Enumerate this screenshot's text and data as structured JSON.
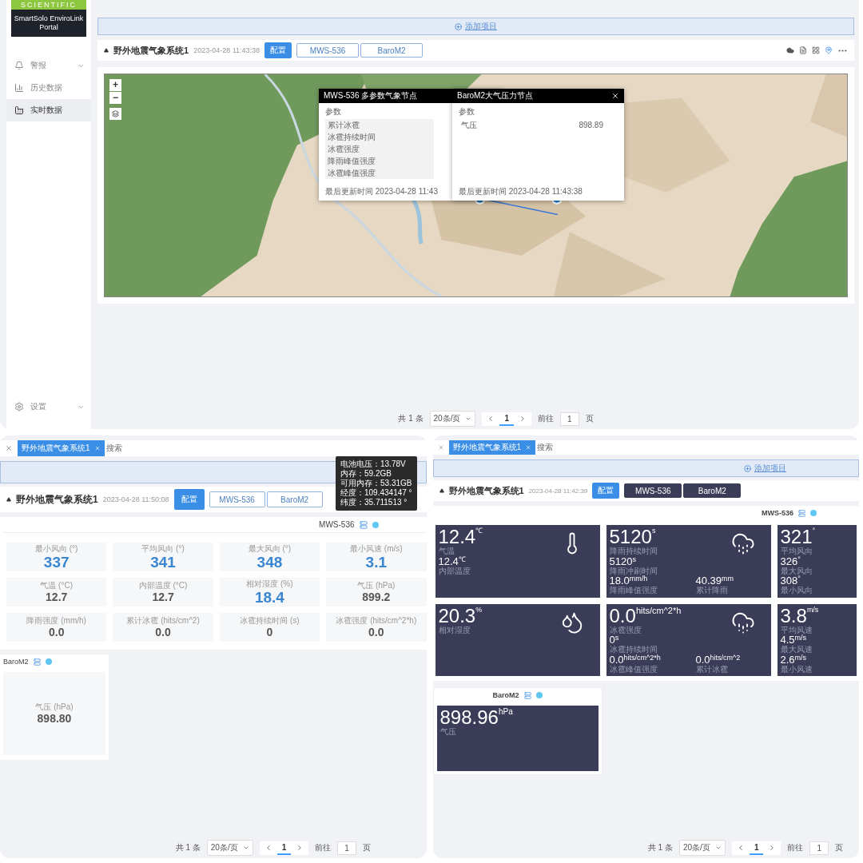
{
  "top": {
    "sidebar": {
      "logo_tagline": "SCIENTIFIC",
      "logo_title": "SmartSolo EnviroLink Portal",
      "items": [
        {
          "label": "警报",
          "kind": "bell",
          "expandable": true,
          "selected": false
        },
        {
          "label": "历史数据",
          "kind": "chart",
          "expandable": false,
          "selected": false
        },
        {
          "label": "实时数据",
          "kind": "factory",
          "expandable": false,
          "selected": true
        }
      ],
      "footer_item": {
        "label": "设置",
        "kind": "gear",
        "expandable": true
      }
    },
    "add_bar": "添加项目",
    "header": {
      "title": "野外地震气象系统1",
      "time": "2023-04-28 11:43:38",
      "config_button": "配置",
      "node_tabs": [
        "MWS-536",
        "BaroM2"
      ]
    },
    "map": {
      "zoom_in": "+",
      "zoom_out": "−",
      "popups": [
        {
          "title": "MWS-536 多参数气象节点",
          "param_header": "参数",
          "rows": [
            {
              "name": "累计冰雹"
            },
            {
              "name": "冰雹持续时间"
            },
            {
              "name": "冰雹强度"
            },
            {
              "name": "降雨峰值强度"
            },
            {
              "name": "冰雹峰值强度"
            }
          ],
          "updated": "最后更新时间  2023-04-28 11:43"
        },
        {
          "title": "BaroM2大气压力节点",
          "param_header": "参数",
          "rows": [
            {
              "name": "气压",
              "value": "898.89"
            }
          ],
          "updated": "最后更新时间  2023-04-28 11:43:38"
        }
      ]
    },
    "pagination": {
      "total": "共 1 条",
      "page_size": "20条/页",
      "pages": [
        {
          "label": "1",
          "selected": true
        }
      ],
      "goto_label": "前往",
      "goto_value": "1",
      "goto_suffix": "页"
    }
  },
  "left": {
    "tabs": [
      {
        "label": "野外地震气象系统1",
        "selected": true
      }
    ],
    "search": "搜索",
    "header": {
      "title": "野外地震气象系统1",
      "time": "2023-04-28 11:50:08",
      "config_button": "配置",
      "node_tabs": [
        "MWS-536",
        "BaroM2"
      ]
    },
    "tooltip": [
      "电池电压：13.78V",
      "内存：59.2GB",
      "可用内存：53.31GB",
      "经度：109.434147 °",
      "纬度：35.711513 °"
    ],
    "node": "MWS-536",
    "stats": [
      {
        "label": "最小风向 (°)",
        "value": "337",
        "highlight": true
      },
      {
        "label": "平均风向 (°)",
        "value": "341",
        "highlight": true
      },
      {
        "label": "最大风向 (°)",
        "value": "348",
        "highlight": true
      },
      {
        "label": "最小风速 (m/s)",
        "value": "3.1",
        "highlight": true
      },
      {
        "label": "气温 (°C)",
        "value": "12.7",
        "highlight": false
      },
      {
        "label": "内部温度 (°C)",
        "value": "12.7",
        "highlight": false
      },
      {
        "label": "相对湿度 (%)",
        "value": "18.4",
        "highlight": true
      },
      {
        "label": "气压 (hPa)",
        "value": "899.2",
        "highlight": false
      },
      {
        "label": "降雨强度 (mm/h)",
        "value": "0.0",
        "highlight": false
      },
      {
        "label": "累计冰雹 (hits/cm^2)",
        "value": "0.0",
        "highlight": false
      },
      {
        "label": "冰雹持续时间 (s)",
        "value": "0",
        "highlight": false
      },
      {
        "label": "冰雹强度 (hits/cm^2*h)",
        "value": "0.0",
        "highlight": false
      }
    ],
    "baro": {
      "node": "BaroM2",
      "label": "气压 (hPa)",
      "value": "898.80"
    },
    "pagination": {
      "total": "共 1 条",
      "page_size": "20条/页",
      "pages": [
        {
          "label": "1",
          "selected": true
        }
      ],
      "goto_label": "前往",
      "goto_value": "1",
      "goto_suffix": "页"
    }
  },
  "right": {
    "tabs": [
      {
        "label": "野外地震气象系统1",
        "selected": true
      }
    ],
    "search": "搜索",
    "add_bar": "添加项目",
    "header": {
      "title": "野外地震气象系统1",
      "time": "2023-04-28 11:42:39",
      "config_button": "配置",
      "node_tabs": [
        "MWS-536",
        "BaroM2"
      ]
    },
    "node": "MWS-536",
    "tiles": [
      {
        "kind": "thermometer",
        "main": {
          "value": "12.4",
          "unit": "℃",
          "label": "气温"
        },
        "subs": [
          [
            {
              "value": "12.4",
              "unit": "℃",
              "label": "内部温度"
            }
          ]
        ]
      },
      {
        "kind": "rain",
        "main": {
          "value": "5120",
          "unit": "s",
          "label": "降雨持续时间"
        },
        "subs": [
          [
            {
              "value": "5120",
              "unit": "s",
              "label": "降雨冲刷时间"
            }
          ],
          [
            {
              "value": "18.0",
              "unit": "mm/h",
              "label": "降雨峰值强度"
            },
            {
              "value": "40.39",
              "unit": "mm",
              "label": "累计降雨"
            }
          ]
        ]
      },
      {
        "kind": "plain",
        "main": {
          "value": "321",
          "unit": "°",
          "label": "平均风向"
        },
        "subs": [
          [
            {
              "value": "326",
              "unit": "°",
              "label": "最大风向"
            }
          ],
          [
            {
              "value": "308",
              "unit": "°",
              "label": "最小风向"
            }
          ]
        ]
      },
      {
        "kind": "drops",
        "main": {
          "value": "20.3",
          "unit": "%",
          "label": "相对湿度"
        }
      },
      {
        "kind": "hail",
        "main": {
          "value": "0.0",
          "unit": "hits/cm^2*h",
          "label": "冰雹强度"
        },
        "subs": [
          [
            {
              "value": "0",
              "unit": "s",
              "label": "冰雹持续时间"
            }
          ],
          [
            {
              "value": "0.0",
              "unit": "hits/cm^2*h",
              "label": "冰雹峰值强度"
            },
            {
              "value": "0.0",
              "unit": "hits/cm^2",
              "label": "累计冰雹"
            }
          ]
        ]
      },
      {
        "kind": "plain",
        "main": {
          "value": "3.8",
          "unit": "m/s",
          "label": "平均风速"
        },
        "subs": [
          [
            {
              "value": "4.5",
              "unit": "m/s",
              "label": "最大风速"
            }
          ],
          [
            {
              "value": "2.6",
              "unit": "m/s",
              "label": "最小风速"
            }
          ]
        ]
      }
    ],
    "baro": {
      "node": "BaroM2",
      "value": "898.96",
      "unit": "hPa",
      "label": "气压"
    },
    "pagination": {
      "total": "共 1 条",
      "page_size": "20条/页",
      "pages": [
        {
          "label": "1",
          "selected": true
        }
      ],
      "goto_label": "前往",
      "goto_value": "1",
      "goto_suffix": "页"
    }
  }
}
